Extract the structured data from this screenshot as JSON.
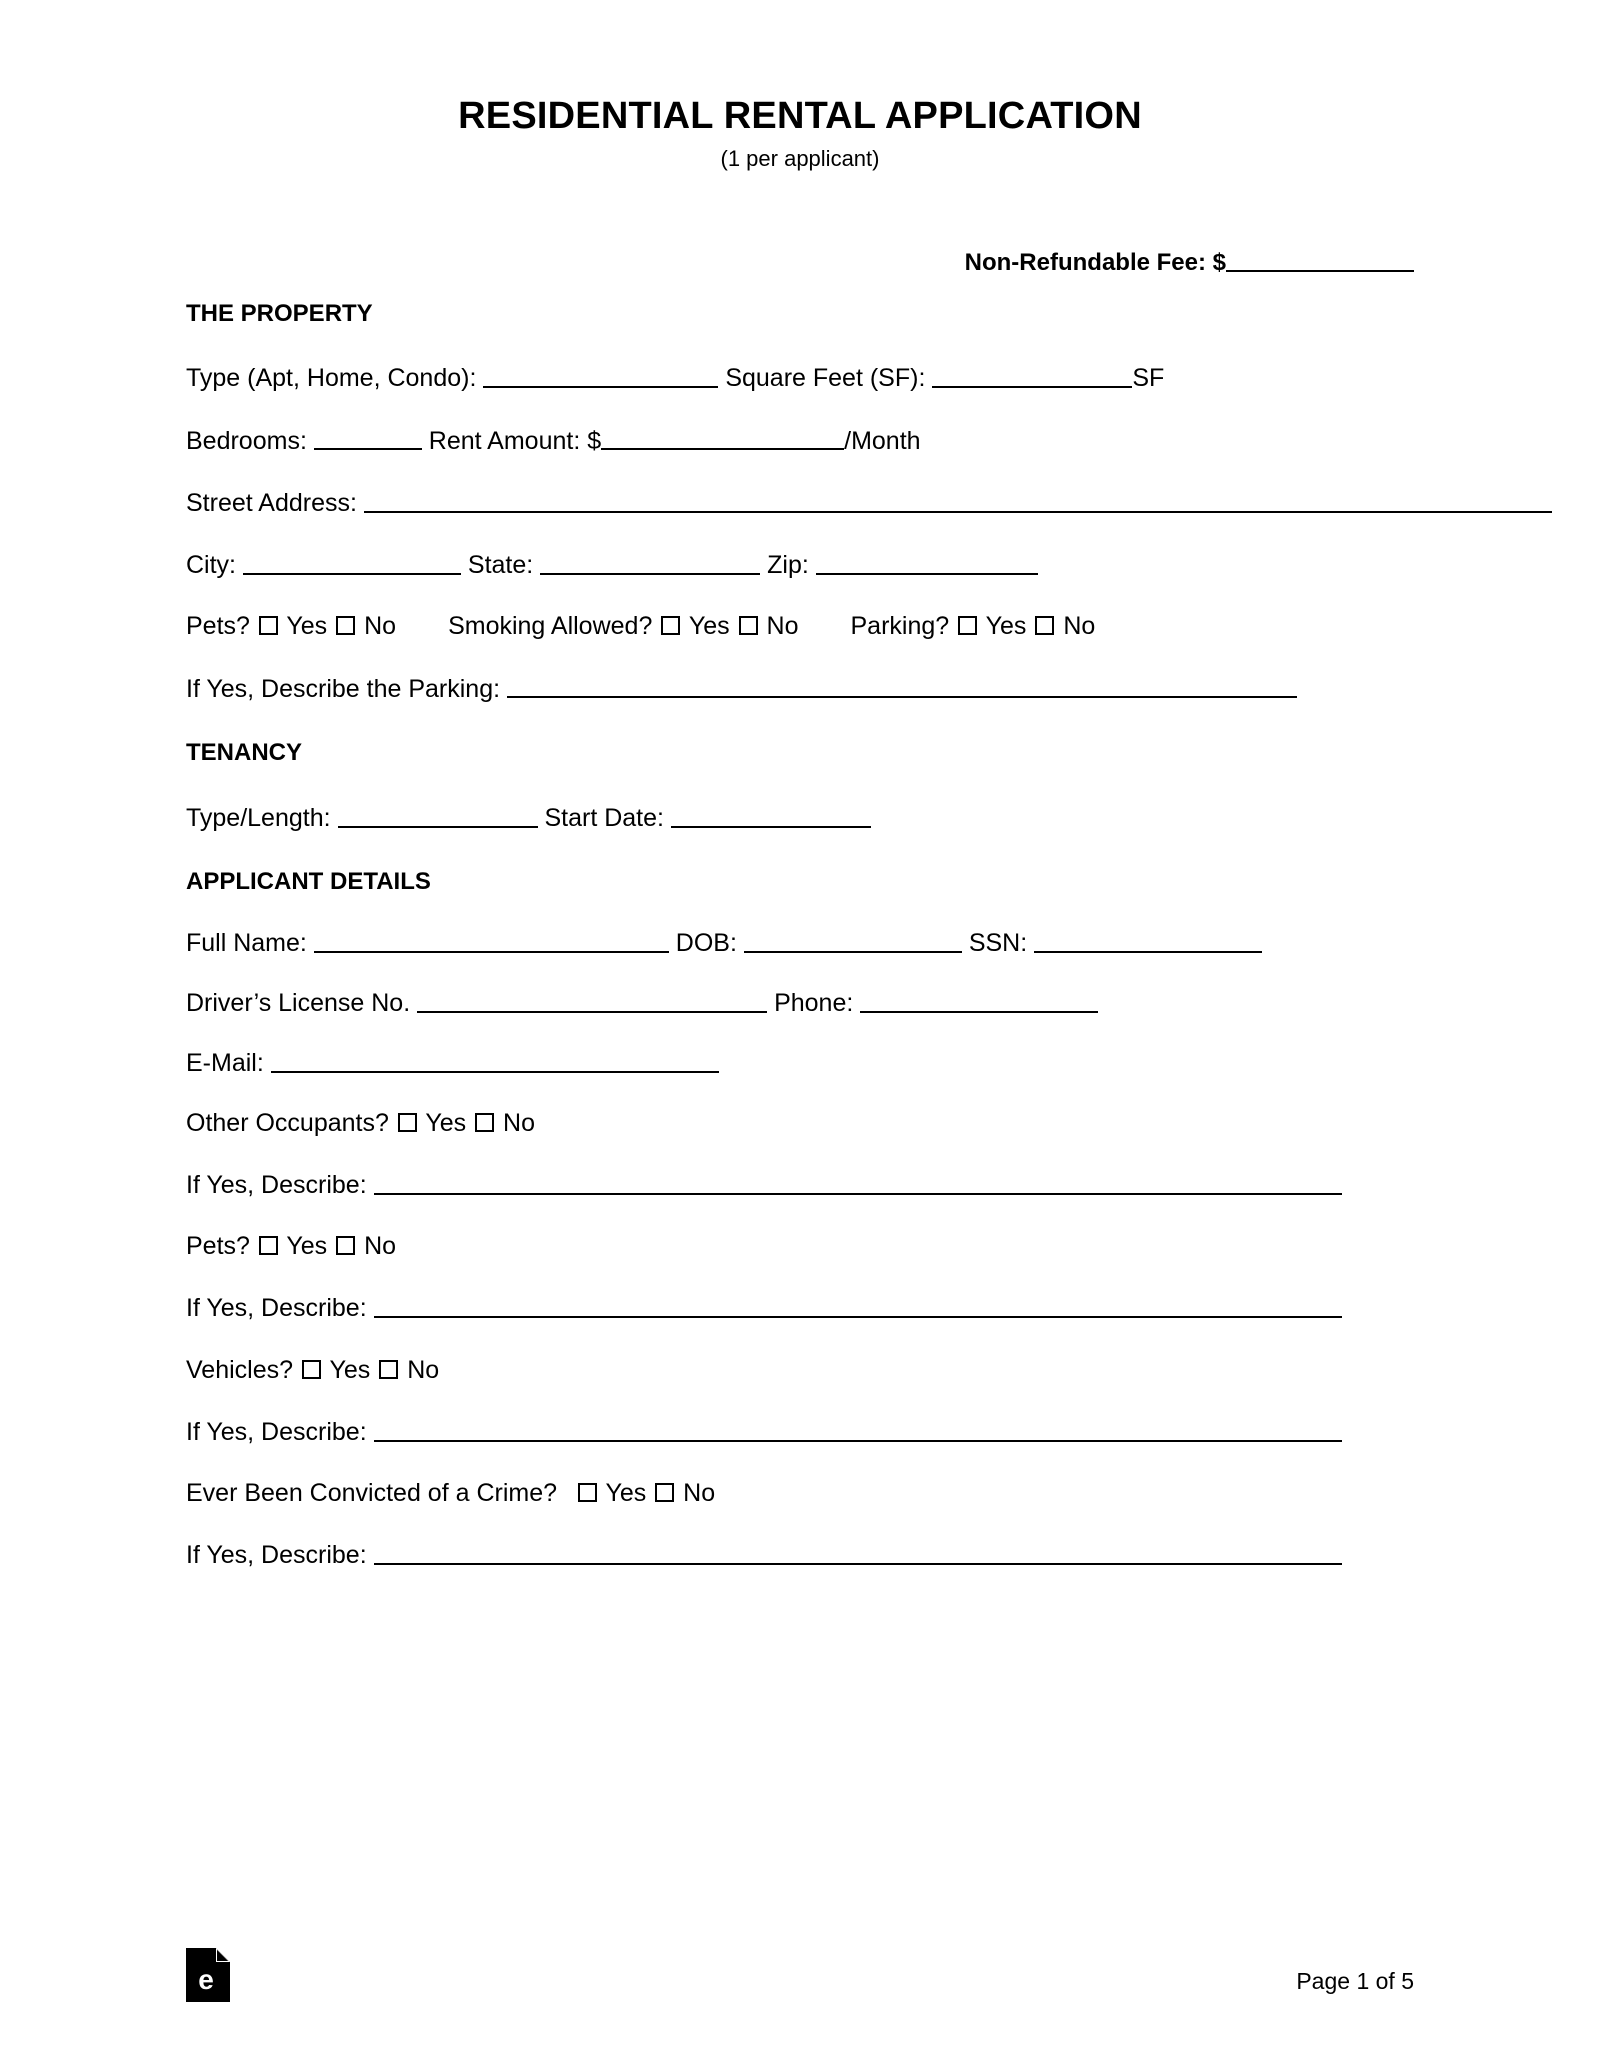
{
  "document": {
    "title": "RESIDENTIAL RENTAL APPLICATION",
    "subtitle": "(1 per applicant)"
  },
  "fee": {
    "label": "Non-Refundable Fee: $"
  },
  "sections": {
    "property": {
      "heading": "THE PROPERTY",
      "type_label": "Type (Apt, Home, Condo):",
      "square_feet_label": "Square Feet (SF):",
      "square_feet_suffix": "SF",
      "bedrooms_label": "Bedrooms:",
      "rent_label": "Rent Amount: $",
      "rent_suffix": "/Month",
      "street_label": "Street Address:",
      "city_label": "City:",
      "state_label": "State:",
      "zip_label": "Zip:",
      "pets_label": "Pets?",
      "smoking_label": "Smoking Allowed?",
      "parking_label": "Parking?",
      "parking_describe_label": "If Yes, Describe the Parking:"
    },
    "tenancy": {
      "heading": "TENANCY",
      "type_length_label": "Type/Length:",
      "start_date_label": "Start Date:"
    },
    "applicant": {
      "heading": "APPLICANT DETAILS",
      "full_name_label": "Full Name:",
      "dob_label": "DOB:",
      "ssn_label": "SSN:",
      "drivers_license_label": "Driver’s License No.",
      "phone_label": "Phone:",
      "email_label": "E-Mail:",
      "other_occupants_label": "Other Occupants?",
      "occupants_describe_label": "If Yes, Describe:",
      "pets_label": "Pets?",
      "pets_describe_label": "If Yes, Describe:",
      "vehicles_label": "Vehicles?",
      "vehicles_describe_label": "If Yes, Describe:",
      "crime_label": "Ever Been Convicted of a Crime?",
      "crime_describe_label": "If Yes, Describe:"
    }
  },
  "choices": {
    "yes": "Yes",
    "no": "No"
  },
  "footer": {
    "logo_letter": "e",
    "page_number": "Page 1 of 5"
  }
}
